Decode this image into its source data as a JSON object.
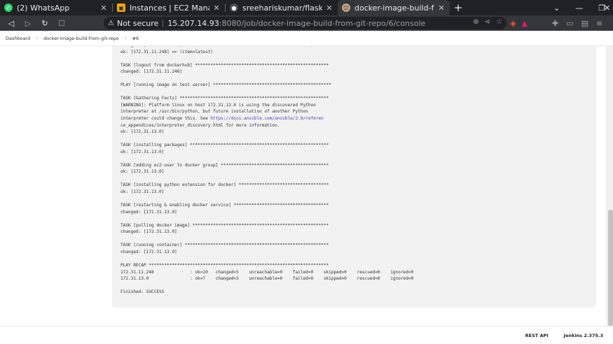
{
  "tabs": [
    {
      "label": "(2) WhatsApp",
      "icon": "whatsapp-icon",
      "color": "#25d366",
      "active": false
    },
    {
      "label": "Instances | EC2 Management C",
      "icon": "aws-icon",
      "color": "#f7a600",
      "active": false
    },
    {
      "label": "sreehariskumar/flask-app Tag",
      "icon": "github-icon",
      "color": "#4d4d4d",
      "active": false
    },
    {
      "label": "docker-image-build-from-",
      "icon": "jenkins-icon",
      "color": "#c6a78b",
      "active": true
    }
  ],
  "address": {
    "warning": "Not secure",
    "host": "15.207.14.93",
    "path": ":8080/job/docker-image-build-from-git-repo/6/console"
  },
  "breadcrumb": [
    "Dashboard",
    "docker-image-build-from-git-repo",
    "#6"
  ],
  "console_lines": [
    "changed: [172.31.11.248] => (item=5360bz1ac8540eb0f59f2710ce5188010625efaa)",
    "ok: [172.31.11.248] => (item=latest)",
    "",
    "TASK [logout from dockerhub] ****************************************************",
    "changed: [172.31.11.248]",
    "",
    "PLAY [running image on test server] **********************************************",
    "",
    "TASK [Gathering Facts] **********************************************************",
    "[WARNING]: Platform linux on host 172.31.13.0 is using the discovered Python",
    "interpreter at /usr/bin/python, but future installation of another Python",
    "interpreter could change this. See https://docs.ansible.com/ansible/2.9/referen",
    "ce_appendices/interpreter_discovery.html for more information.",
    "ok: [172.31.13.0]",
    "",
    "TASK [installing packages] ******************************************************",
    "ok: [172.31.13.0]",
    "",
    "TASK [adding ec2-user to docker group] ******************************************",
    "ok: [172.31.13.0]",
    "",
    "TASK [installing python extension for docker] ***********************************",
    "ok: [172.31.13.0]",
    "",
    "TASK [restarting & enabling docker service] *************************************",
    "changed: [172.31.13.0]",
    "",
    "TASK [pulling docker image] *****************************************************",
    "changed: [172.31.13.0]",
    "",
    "TASK [running container] ********************************************************",
    "changed: [172.31.13.0]",
    "",
    "PLAY RECAP **********************************************************************",
    "172.31.11.248              : ok=10   changed=5    unreachable=0    failed=0    skipped=0    rescued=0    ignored=0",
    "172.31.13.0                : ok=7    changed=3    unreachable=0    failed=0    skipped=0    rescued=0    ignored=0",
    "",
    "Finished: SUCCESS"
  ],
  "link_text": "https://docs.ansible.com/ansible/2.9/referen",
  "footer": {
    "rest_api": "REST API",
    "version": "Jenkins 2.375.3"
  }
}
